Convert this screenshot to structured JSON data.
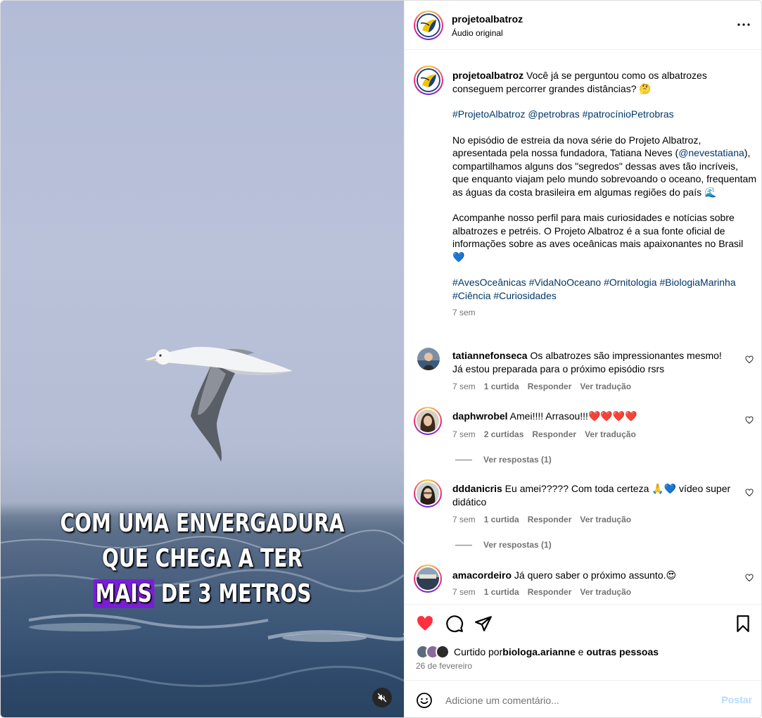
{
  "colors": {
    "accent_link": "#00376b",
    "muted": "#737373",
    "heart": "#ff3040",
    "caption_highlight": "#7a1ed6",
    "post_btn_disabled": "#b3dbff"
  },
  "header": {
    "username": "projetoalbatroz",
    "subtitle": "Áudio original",
    "more_icon": "more-horizontal-icon"
  },
  "media": {
    "overlay_lines": [
      "COM UMA ENVERGADURA",
      "QUE CHEGA A TER"
    ],
    "overlay_highlight": "MAIS",
    "overlay_last_rest": " DE 3 METROS",
    "mute_icon": "speaker-muted-icon"
  },
  "caption": {
    "username": "projetoalbatroz",
    "intro": " Você já se perguntou como os albatrozes conseguem percorrer grandes distâncias? 🤔",
    "tags_line1": "#ProjetoAlbatroz @petrobras #patrocínioPetrobras",
    "para2_a": "No episódio de estreia da nova série do Projeto Albatroz, apresentada pela nossa fundadora, Tatiana Neves (",
    "para2_mention": "@nevestatiana",
    "para2_b": "), compartilhamos alguns dos \"segredos\" dessas aves tão incríveis, que enquanto viajam pelo mundo sobrevoando o oceano, frequentam as águas da costa brasileira em algumas regiões do país 🌊",
    "para3": "Acompanhe nosso perfil para mais curiosidades e notícias sobre albatrozes e petréis. O Projeto Albatroz é a sua fonte oficial de informações sobre as aves oceânicas mais apaixonantes no Brasil 💙",
    "tags_line2": "#AvesOceânicas #VidaNoOceano #Ornitologia #BiologiaMarinha #Ciência #Curiosidades",
    "time": "7 sem"
  },
  "comments": [
    {
      "username": "tatiannefonseca",
      "text": " Os albatrozes são impressionantes mesmo! Já estou preparada para o próximo episódio rsrs",
      "time": "7 sem",
      "likes": "1 curtida",
      "reply": "Responder",
      "translate": "Ver tradução"
    },
    {
      "username": "daphwrobel",
      "text": " Amei!!!! Arrasou!!!❤️❤️❤️❤️",
      "time": "7 sem",
      "likes": "2 curtidas",
      "reply": "Responder",
      "translate": "Ver tradução",
      "replies": "Ver respostas (1)"
    },
    {
      "username": "dddanicris",
      "text": " Eu amei????? Com toda certeza 🙏💙 vídeo super didático",
      "time": "7 sem",
      "likes": "1 curtida",
      "reply": "Responder",
      "translate": "Ver tradução",
      "replies": "Ver respostas (1)"
    },
    {
      "username": "amacordeiro",
      "text": " Já quero saber o próximo assunto.😍",
      "time": "7 sem",
      "likes": "1 curtida",
      "reply": "Responder",
      "translate": "Ver tradução"
    }
  ],
  "actions": {
    "like_icon": "heart-filled-icon",
    "comment_icon": "comment-icon",
    "share_icon": "send-icon",
    "save_icon": "bookmark-icon",
    "liked_by_prefix": "Curtido por ",
    "liked_by_user": "biologa.arianne",
    "liked_by_mid": " e ",
    "liked_by_others": "outras pessoas",
    "date": "26 de fevereiro"
  },
  "composer": {
    "emoji_icon": "emoji-icon",
    "placeholder": "Adicione um comentário...",
    "post_label": "Postar"
  }
}
